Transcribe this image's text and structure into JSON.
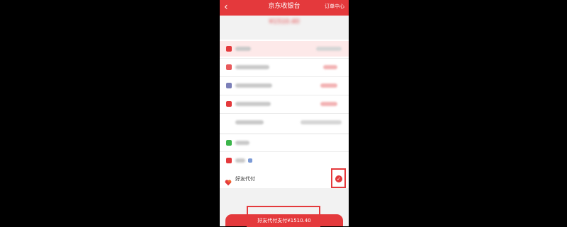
{
  "header": {
    "back_icon": "back-arrow-icon",
    "title": "京东收银台",
    "orders_link": "订单中心"
  },
  "payment_options": {
    "friend_pay_label": "好友代付",
    "friend_pay_selected": true,
    "friend_icon": "friends-icon",
    "check_icon": "checkmark-icon"
  },
  "pay_button": {
    "label": "好友代付支付¥1510.40"
  },
  "colors": {
    "brand_red": "#e4393c",
    "background": "#f2f2f2"
  }
}
